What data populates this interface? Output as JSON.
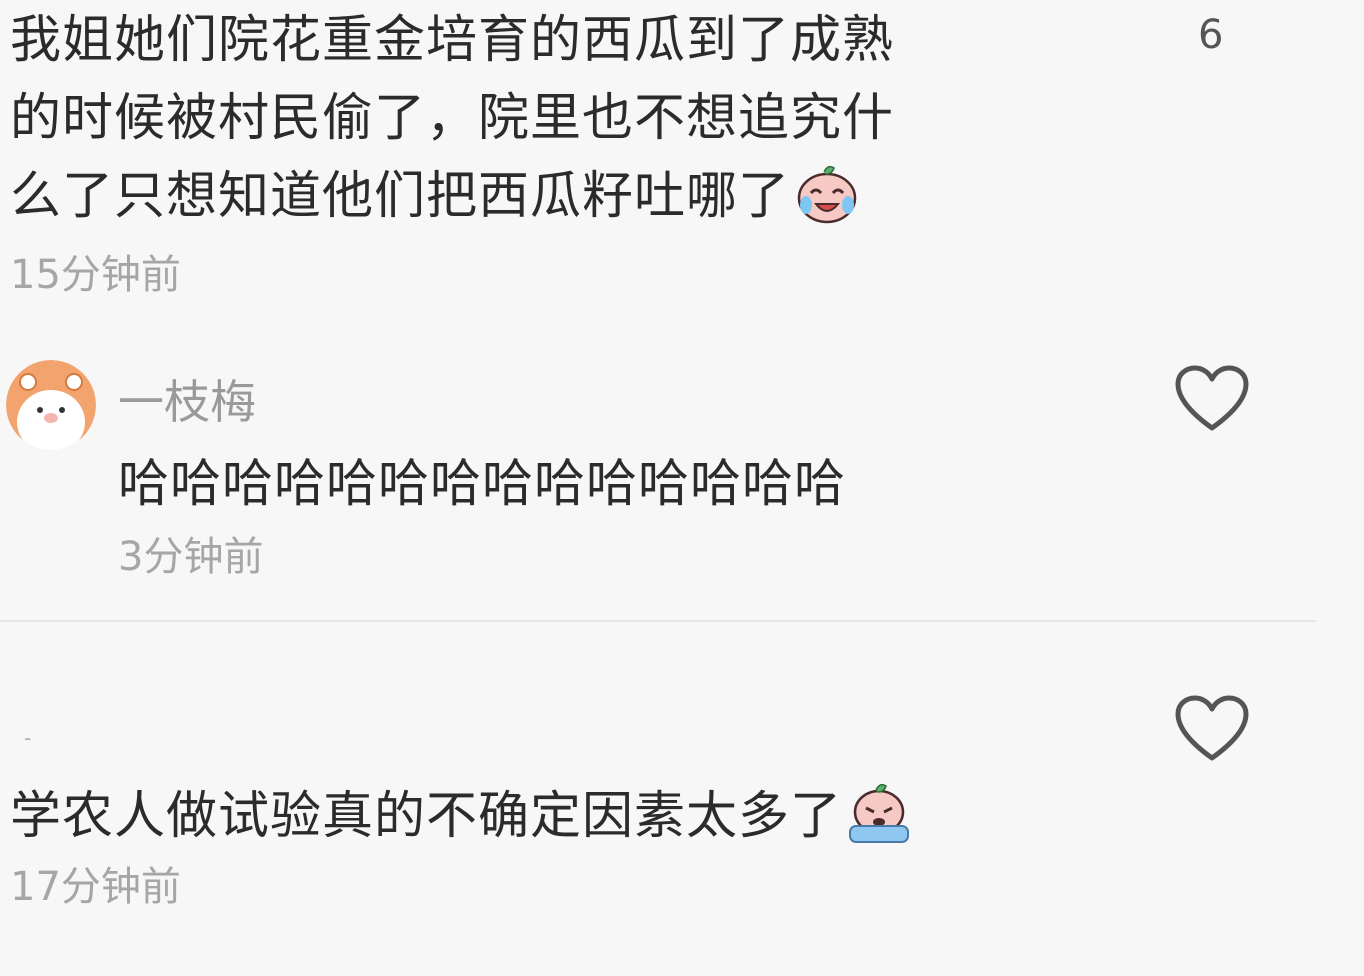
{
  "comment1": {
    "lines": [
      "我姐她们院花重金培育的西瓜到了成熟",
      "的时候被村民偷了，院里也不想追究什",
      "么了只想知道他们把西瓜籽吐哪了"
    ],
    "emoji": "laughing-crying-emoji",
    "time": "15分钟前",
    "likes": "6"
  },
  "comment2": {
    "username": "一枝梅",
    "text": "哈哈哈哈哈哈哈哈哈哈哈哈哈哈",
    "time": "3分钟前"
  },
  "comment3": {
    "username": "-",
    "text": "学农人做试验真的不确定因素太多了",
    "emoji": "crying-emoji",
    "time": "17分钟前"
  },
  "colors": {
    "background": "#f7f7f7",
    "text": "#2b2b2b",
    "muted": "#a6a6a6",
    "heart_stroke": "#555555"
  }
}
